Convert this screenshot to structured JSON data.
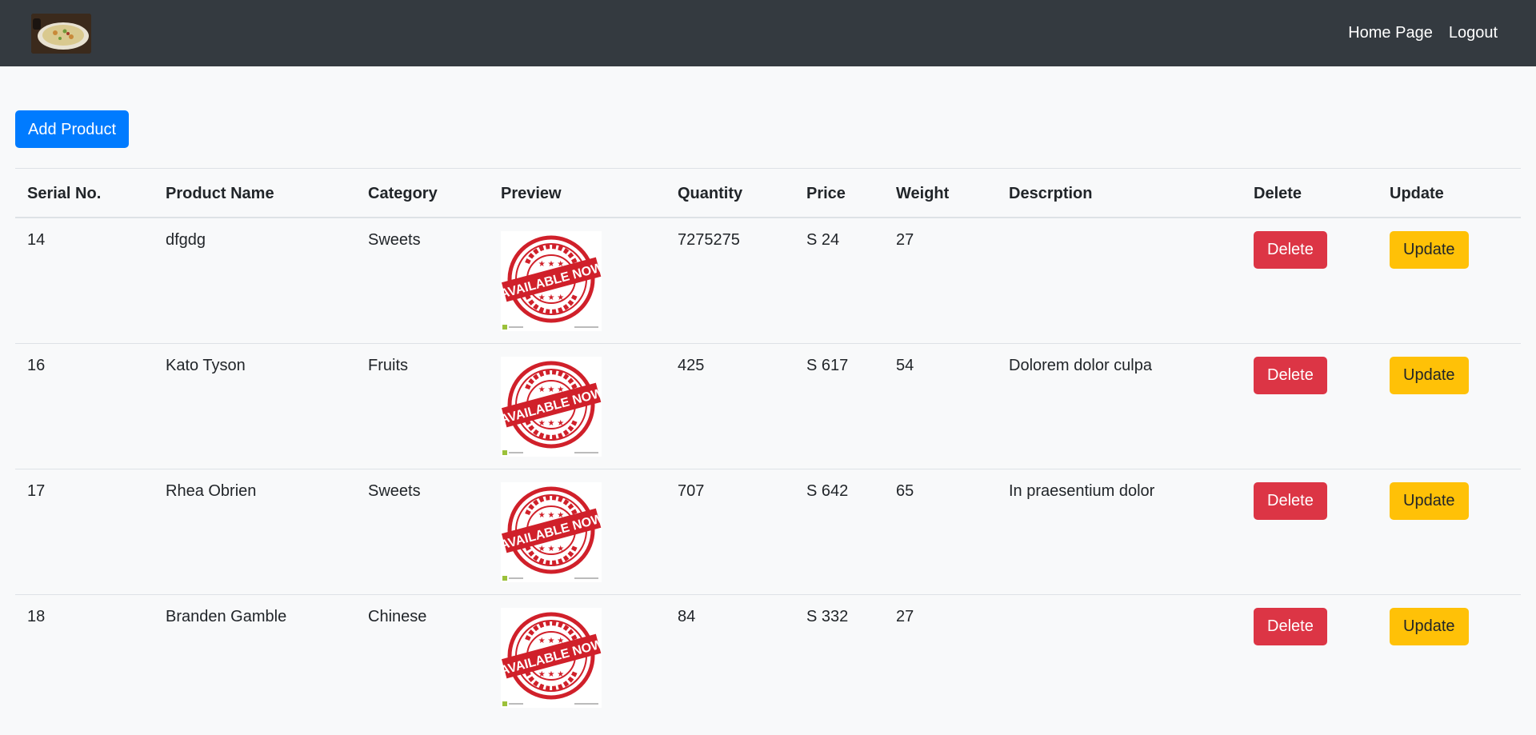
{
  "navbar": {
    "logo_alt": "food logo",
    "links": [
      "Home Page",
      "Logout"
    ]
  },
  "toolbar": {
    "add_label": "Add Product"
  },
  "table": {
    "headers": [
      "Serial No.",
      "Product Name",
      "Category",
      "Preview",
      "Quantity",
      "Price",
      "Weight",
      "Descrption",
      "Delete",
      "Update"
    ],
    "rows": [
      {
        "serial": "14",
        "name": "dfgdg",
        "category": "Sweets",
        "quantity": "7275275",
        "price": "S 24",
        "weight": "27",
        "description": "",
        "delete": "Delete",
        "update": "Update"
      },
      {
        "serial": "16",
        "name": "Kato Tyson",
        "category": "Fruits",
        "quantity": "425",
        "price": "S 617",
        "weight": "54",
        "description": "Dolorem dolor culpa",
        "delete": "Delete",
        "update": "Update"
      },
      {
        "serial": "17",
        "name": "Rhea Obrien",
        "category": "Sweets",
        "quantity": "707",
        "price": "S 642",
        "weight": "65",
        "description": "In praesentium dolor",
        "delete": "Delete",
        "update": "Update"
      },
      {
        "serial": "18",
        "name": "Branden Gamble",
        "category": "Chinese",
        "quantity": "84",
        "price": "S 332",
        "weight": "27",
        "description": "",
        "delete": "Delete",
        "update": "Update"
      }
    ],
    "preview_stamp_text": "AVAILABLE NOW"
  },
  "colors": {
    "navbar": "#343a40",
    "primary": "#007bff",
    "danger": "#dc3545",
    "warning": "#ffc107",
    "stamp_red": "#d0202a"
  }
}
